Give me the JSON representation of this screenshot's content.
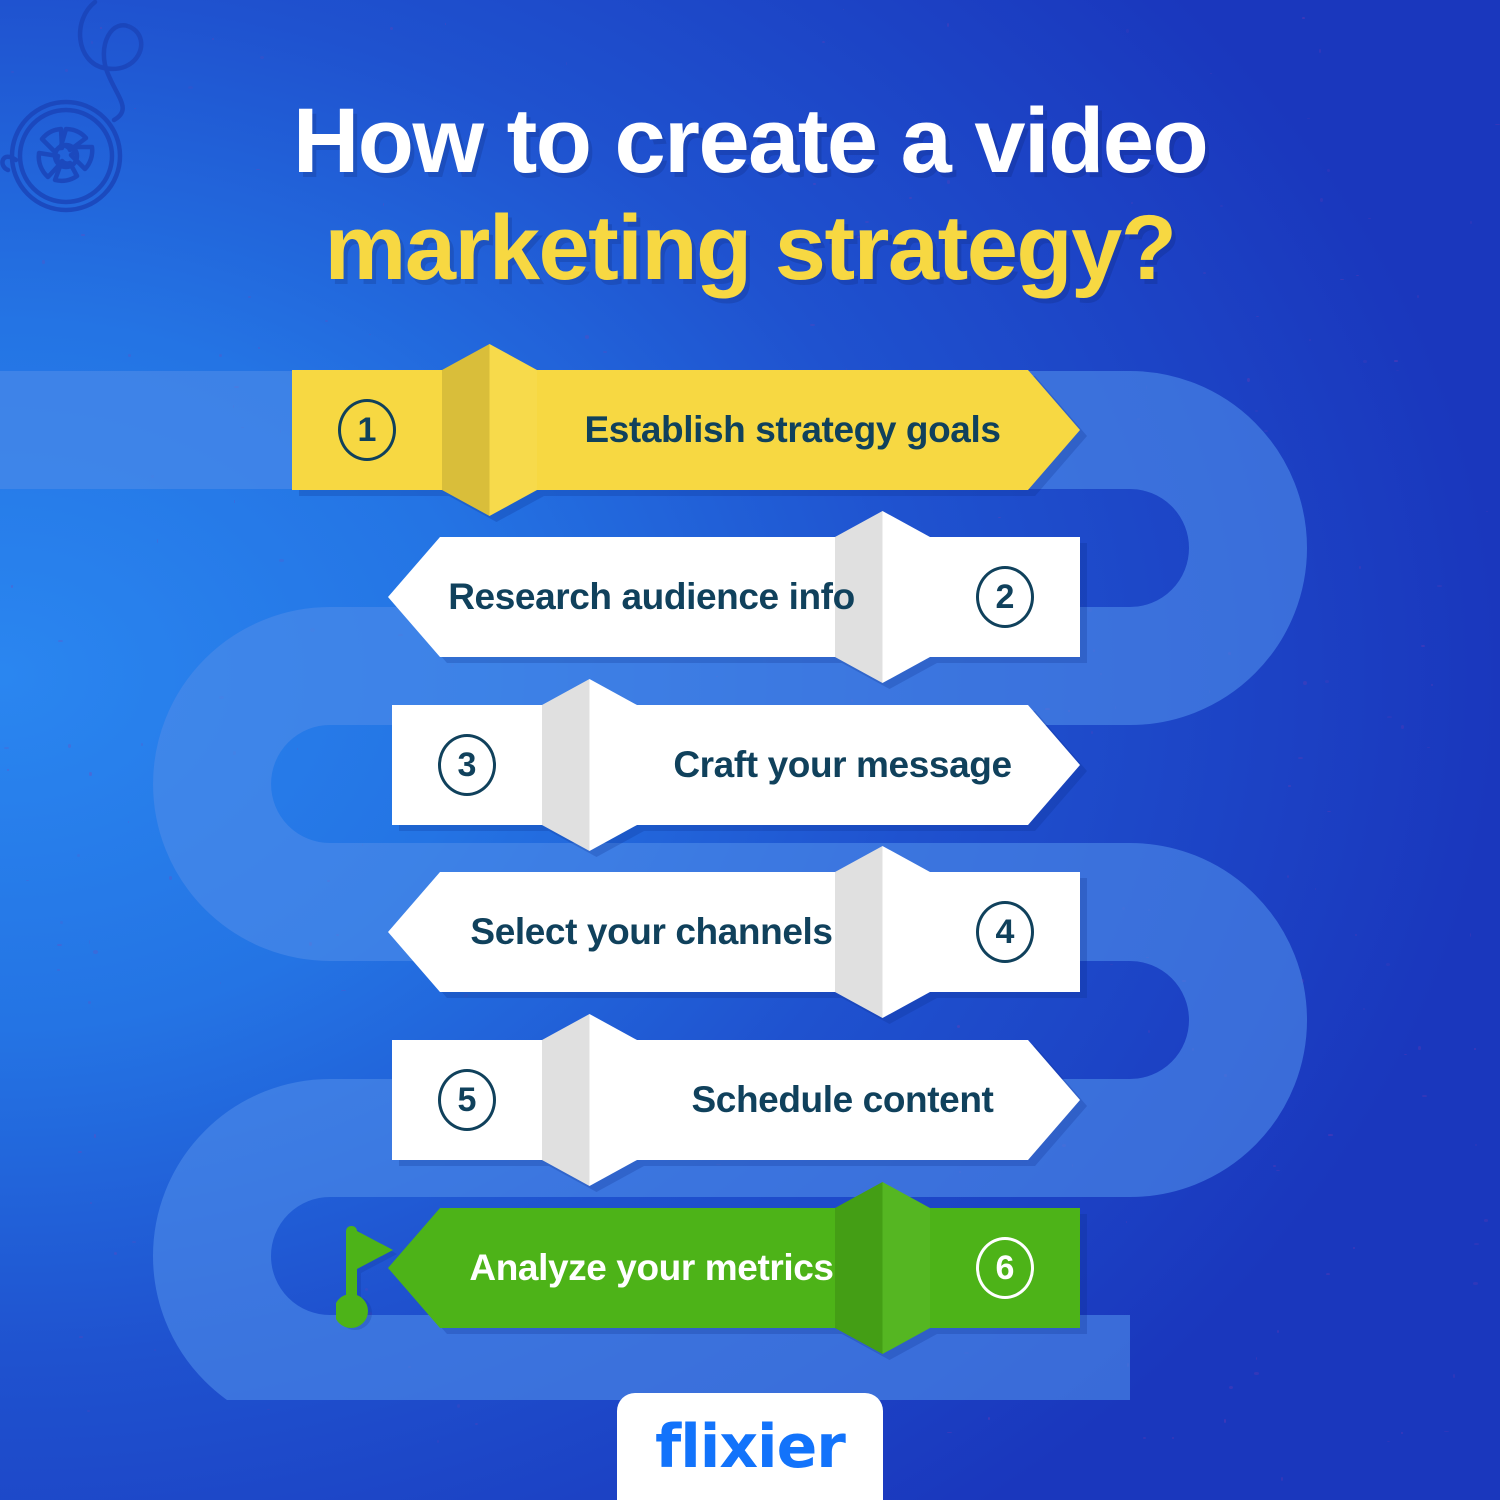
{
  "title": {
    "line1": "How to create a video",
    "line2": "marketing strategy?"
  },
  "colors": {
    "bg_light_blue": "#2a86f0",
    "bg_deep_blue": "#1a37bd",
    "path_track": "#4e8ae8",
    "accent_yellow": "#f7d842",
    "accent_green": "#4db318",
    "text_navy": "#10415c",
    "white": "#ffffff",
    "logo_blue": "#1273fb"
  },
  "steps": [
    {
      "number": "1",
      "label": "Establish strategy goals",
      "direction": "right",
      "number_side": "left",
      "fill": "#f7d842",
      "text_color": "#10415c"
    },
    {
      "number": "2",
      "label": "Research audience info",
      "direction": "left",
      "number_side": "right",
      "fill": "#ffffff",
      "text_color": "#10415c"
    },
    {
      "number": "3",
      "label": "Craft your message",
      "direction": "right",
      "number_side": "left",
      "fill": "#ffffff",
      "text_color": "#10415c"
    },
    {
      "number": "4",
      "label": "Select your channels",
      "direction": "left",
      "number_side": "right",
      "fill": "#ffffff",
      "text_color": "#10415c"
    },
    {
      "number": "5",
      "label": "Schedule content",
      "direction": "right",
      "number_side": "left",
      "fill": "#ffffff",
      "text_color": "#10415c"
    },
    {
      "number": "6",
      "label": "Analyze your metrics",
      "direction": "left",
      "number_side": "right",
      "fill": "#4db318",
      "text_color": "#ffffff"
    }
  ],
  "icons": {
    "film_reel": "film-reel-icon",
    "finish_flag": "finish-flag-icon"
  },
  "logo": {
    "text": "flixier"
  }
}
